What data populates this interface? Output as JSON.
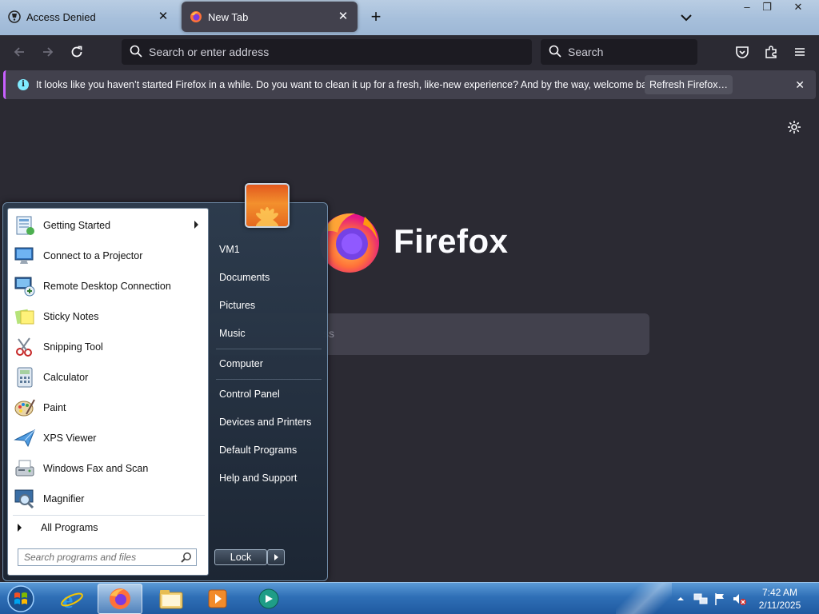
{
  "browser": {
    "tabs": [
      {
        "title": "Access Denied",
        "active": false
      },
      {
        "title": "New Tab",
        "active": true
      }
    ],
    "window_controls": {
      "minimize": "–",
      "restore": "❐",
      "close": "✕"
    },
    "url_placeholder": "Search or enter address",
    "search_placeholder": "Search",
    "notification": {
      "message": "It looks like you haven’t started Firefox in a while. Do you want to clean it up for a fresh, like-new experience? And by the way, welcome back!",
      "button": "Refresh Firefox…"
    },
    "newtab": {
      "brand": "Firefox",
      "search_placeholder_partial": "ss"
    },
    "colors": {
      "toolbar": "#2b2a33",
      "field": "#1c1b22",
      "notice": "#42414d",
      "accent": "#c860ff"
    }
  },
  "start_menu": {
    "programs": [
      {
        "label": "Getting Started",
        "icon": "getting-started-icon",
        "submenu": true
      },
      {
        "label": "Connect to a Projector",
        "icon": "projector-icon",
        "submenu": false
      },
      {
        "label": "Remote Desktop Connection",
        "icon": "remote-desktop-icon",
        "submenu": false
      },
      {
        "label": "Sticky Notes",
        "icon": "sticky-notes-icon",
        "submenu": false
      },
      {
        "label": "Snipping Tool",
        "icon": "scissors-icon",
        "submenu": false
      },
      {
        "label": "Calculator",
        "icon": "calculator-icon",
        "submenu": false
      },
      {
        "label": "Paint",
        "icon": "paint-palette-icon",
        "submenu": false
      },
      {
        "label": "XPS Viewer",
        "icon": "xps-viewer-icon",
        "submenu": false
      },
      {
        "label": "Windows Fax and Scan",
        "icon": "fax-icon",
        "submenu": false
      },
      {
        "label": "Magnifier",
        "icon": "magnifier-icon",
        "submenu": false
      }
    ],
    "all_programs": "All Programs",
    "search_placeholder": "Search programs and files",
    "right_items": [
      "VM1",
      "Documents",
      "Pictures",
      "Music",
      "Computer",
      "Control Panel",
      "Devices and Printers",
      "Default Programs",
      "Help and Support"
    ],
    "lock_button": "Lock"
  },
  "taskbar": {
    "items": [
      "start-orb",
      "internet-explorer",
      "firefox",
      "windows-explorer",
      "media-player",
      "remote-assistance"
    ],
    "time": "7:42 AM",
    "date": "2/11/2025"
  }
}
